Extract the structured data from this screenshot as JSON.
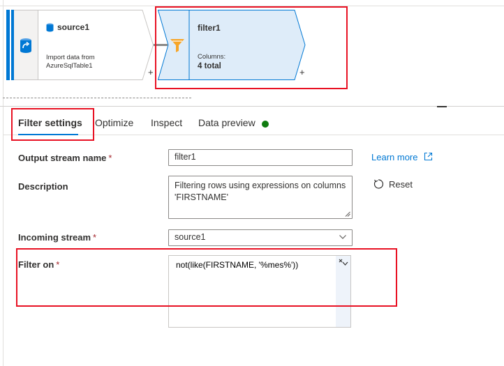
{
  "canvas": {
    "source_node": {
      "title": "source1",
      "description_line1": "Import data from",
      "description_line2": "AzureSqlTable1",
      "add_symbol": "+"
    },
    "filter_node": {
      "title": "filter1",
      "columns_label": "Columns:",
      "columns_total": "4 total",
      "add_symbol": "+"
    }
  },
  "tabs": [
    {
      "label": "Filter settings",
      "active": true
    },
    {
      "label": "Optimize"
    },
    {
      "label": "Inspect"
    },
    {
      "label": "Data preview"
    }
  ],
  "form": {
    "output_stream": {
      "label": "Output stream name",
      "required": "*",
      "value": "filter1"
    },
    "description": {
      "label": "Description",
      "value": "Filtering rows using expressions on columns 'FIRSTNAME'"
    },
    "incoming_stream": {
      "label": "Incoming stream",
      "required": "*",
      "value": "source1"
    },
    "filter_on": {
      "label": "Filter on",
      "required": "*",
      "expression": "not(like(FIRSTNAME, '%mes%'))"
    }
  },
  "actions": {
    "learn_more": "Learn more",
    "reset": "Reset"
  },
  "colors": {
    "accent": "#0078d4",
    "highlight": "#e81123",
    "status_ok": "#107c10",
    "node_selected_fill": "#deecf9"
  },
  "icons": [
    "sql-database-icon",
    "source-refresh-icon",
    "filter-funnel-icon",
    "external-link-icon",
    "reset-icon",
    "chevron-down-icon",
    "expression-expand-icon"
  ]
}
